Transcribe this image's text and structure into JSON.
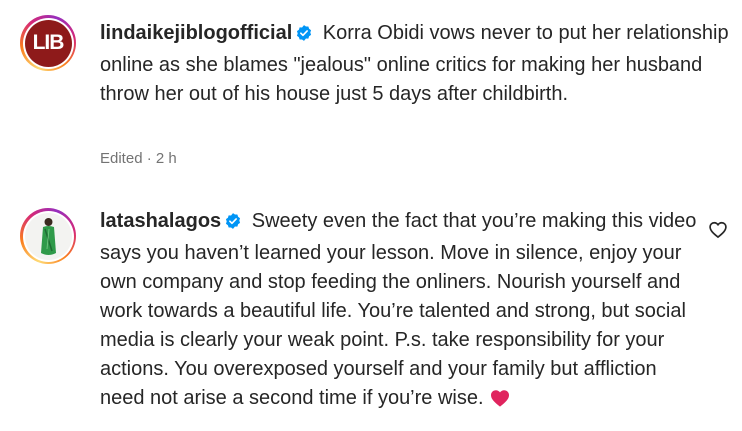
{
  "comment1": {
    "username": "lindaikejiblogofficial",
    "avatar_text": "LIB",
    "text": "Korra Obidi vows never to put her relationship online as she blames \"jealous\" online critics for making her husband throw her out of his house just 5 days after childbirth.",
    "meta": "Edited · 2 h",
    "verified_icon": "verified-badge-icon"
  },
  "comment2": {
    "username": "latashalagos",
    "text": "Sweety even the fact that you’re making this video says you haven’t learned your lesson. Move in silence, enjoy your own company and stop feeding the onliners. Nourish yourself and work towards a beautiful life. You’re talented and strong, but social media is clearly your weak point. P.s. take responsibility for your actions. You overexposed yourself and your family but affliction need not arise a second time if you’re wise.",
    "verified_icon": "verified-badge-icon",
    "end_emoji": "red-heart-icon",
    "like_icon": "heart-outline-icon"
  },
  "colors": {
    "verified_blue": "#0095f6",
    "text": "#262626",
    "meta": "#737373",
    "lib_logo": "#8e1a1a",
    "heart_red": "#e0245e"
  }
}
